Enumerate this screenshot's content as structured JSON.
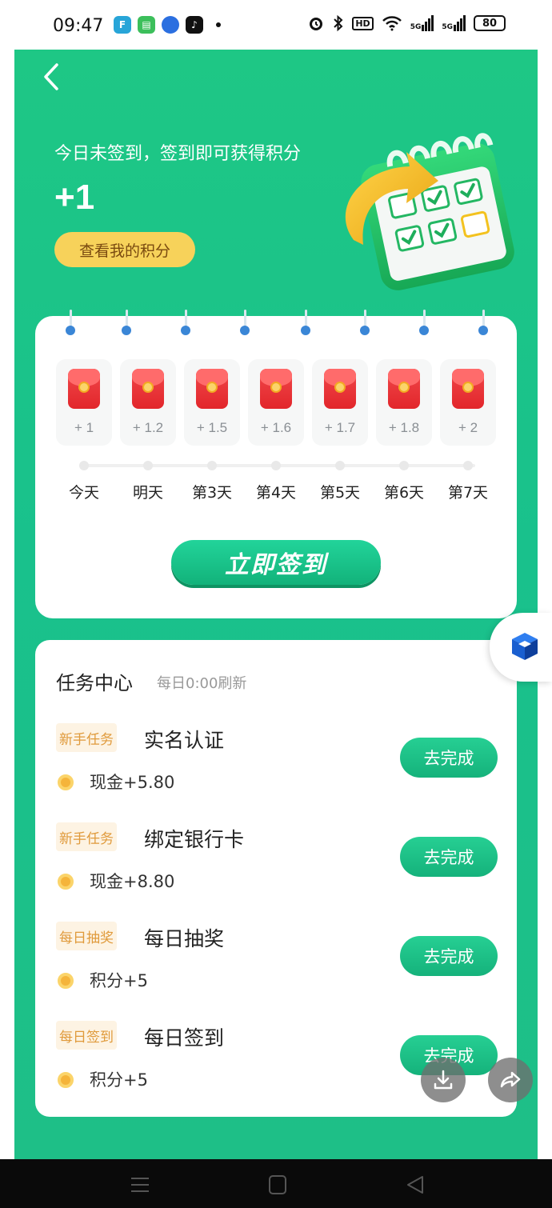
{
  "status_bar": {
    "time": "09:47",
    "battery": "80",
    "network_1": "5G",
    "network_2": "5G",
    "hd_badge": "HD",
    "icons": [
      "alarm-icon",
      "bluetooth-icon",
      "hd-icon",
      "wifi-icon",
      "signal-icon",
      "signal-icon",
      "battery-icon"
    ]
  },
  "header": {
    "subtitle": "今日未签到，签到即可获得积分",
    "points_gain": "+1",
    "view_points_label": "查看我的积分"
  },
  "sign_in": {
    "days": [
      {
        "label": "今天",
        "value": "+ 1"
      },
      {
        "label": "明天",
        "value": "+ 1.2"
      },
      {
        "label": "第3天",
        "value": "+ 1.5"
      },
      {
        "label": "第4天",
        "value": "+ 1.6"
      },
      {
        "label": "第5天",
        "value": "+ 1.7"
      },
      {
        "label": "第6天",
        "value": "+ 1.8"
      },
      {
        "label": "第7天",
        "value": "+ 2"
      }
    ],
    "button_label": "立即签到"
  },
  "tasks": {
    "title": "任务中心",
    "refresh_note": "每日0:00刷新",
    "items": [
      {
        "tag": "新手任务",
        "name": "实名认证",
        "reward": "现金+5.80",
        "action": "去完成"
      },
      {
        "tag": "新手任务",
        "name": "绑定银行卡",
        "reward": "现金+8.80",
        "action": "去完成"
      },
      {
        "tag": "每日抽奖",
        "name": "每日抽奖",
        "reward": "积分+5",
        "action": "去完成"
      },
      {
        "tag": "每日签到",
        "name": "每日签到",
        "reward": "积分+5",
        "action": "去完成"
      }
    ]
  },
  "colors": {
    "brand_green": "#1ec785",
    "button_green": "#15b27b",
    "gold": "#f7d25a",
    "tag_text": "#e09a3b"
  }
}
